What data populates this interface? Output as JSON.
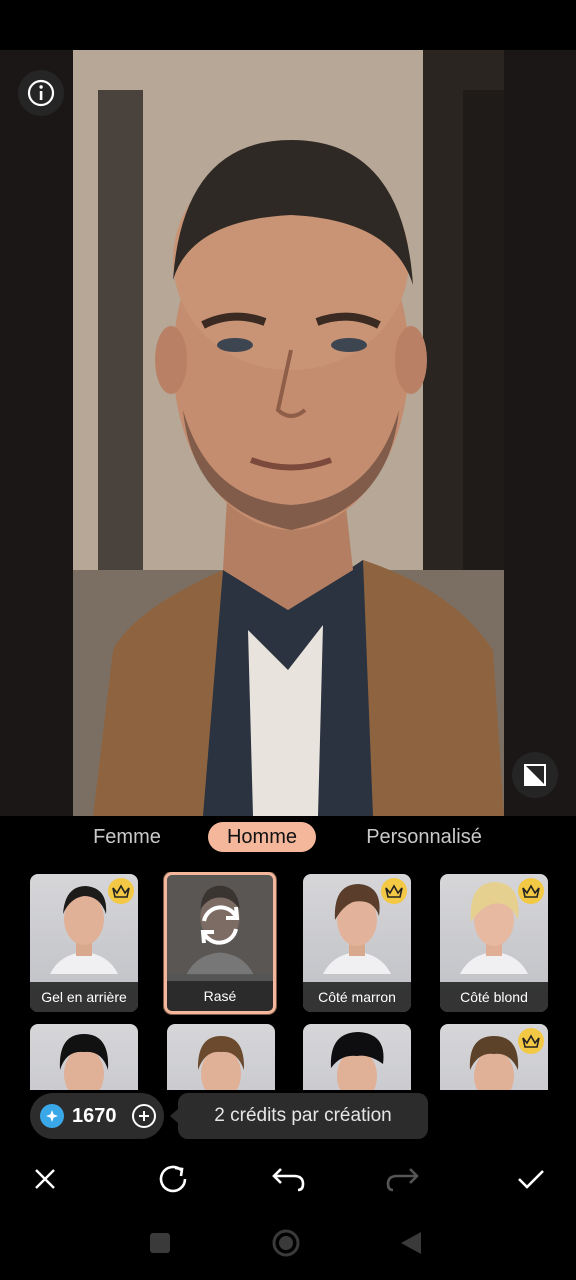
{
  "tabs": [
    {
      "label": "Femme"
    },
    {
      "label": "Homme"
    },
    {
      "label": "Personnalisé"
    }
  ],
  "active_tab": "Homme",
  "styles": [
    {
      "label": "Gel en arrière",
      "premium": true,
      "selected": false,
      "hair_color": "#1d1a1a"
    },
    {
      "label": "Rasé",
      "premium": false,
      "selected": true,
      "hair_color": "#3b3532"
    },
    {
      "label": "Côté marron",
      "premium": true,
      "selected": false,
      "hair_color": "#5a3e2b"
    },
    {
      "label": "Côté blond",
      "premium": true,
      "selected": false,
      "hair_color": "#e6d090"
    },
    {
      "label": "",
      "premium": false,
      "selected": false,
      "hair_color": "#111111"
    },
    {
      "label": "",
      "premium": false,
      "selected": false,
      "hair_color": "#6b4a2e"
    },
    {
      "label": "",
      "premium": false,
      "selected": false,
      "hair_color": "#0e0e10"
    },
    {
      "label": "",
      "premium": true,
      "selected": false,
      "hair_color": "#5c4228"
    }
  ],
  "credits": {
    "value": "1670",
    "hint": "2 crédits par création"
  },
  "colors": {
    "accent": "#f4b79c",
    "crown": "#f3c844",
    "gem": "#3aa7e8",
    "panel_bg": "#000000",
    "pill_bg": "#2c2c2c"
  },
  "icons": {
    "info": "info-icon",
    "compare": "compare-icon",
    "close": "close-icon",
    "regenerate": "refresh-icon",
    "undo": "undo-icon",
    "redo": "redo-icon",
    "confirm": "check-icon",
    "crown": "crown-icon",
    "gem": "gem-icon",
    "add": "plus-circle-icon"
  }
}
